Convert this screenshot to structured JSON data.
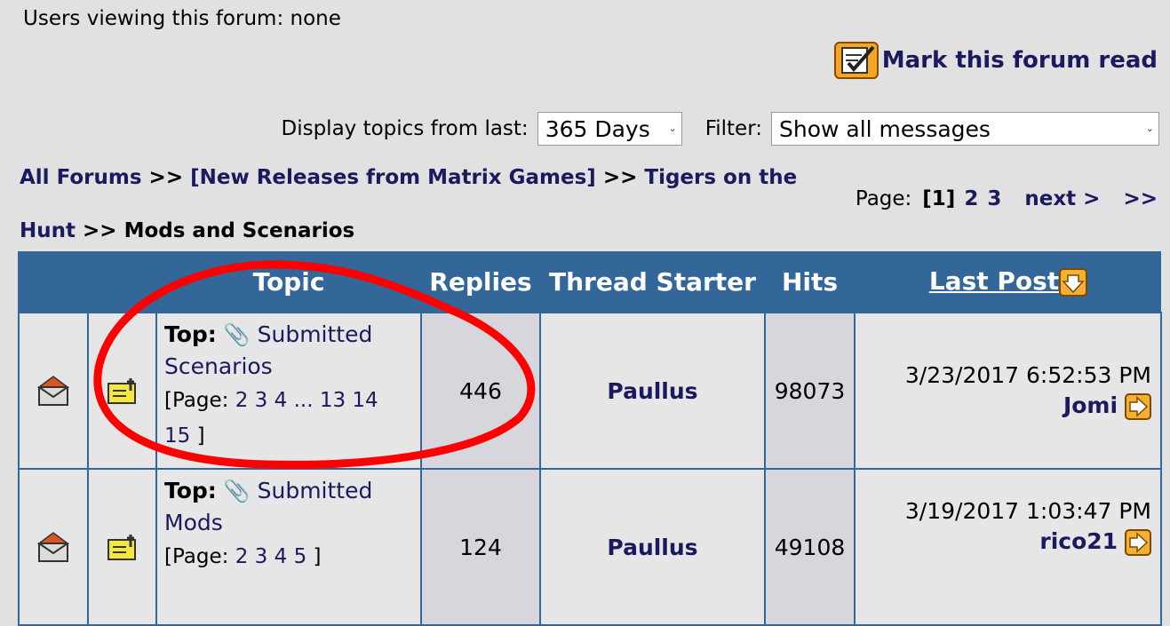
{
  "viewers": "Users viewing this forum: none",
  "mark_read": "Mark this forum read",
  "filters": {
    "display_label": "Display topics from last:",
    "days_value": "365 Days",
    "filter_label": "Filter:",
    "filter_value": "Show all messages"
  },
  "breadcrumb": {
    "all_forums": "All Forums",
    "sep1": ">>",
    "new_releases": "[New Releases from Matrix Games]",
    "sep2": ">>",
    "game_part1": "Tigers on the",
    "game_part2": "Hunt",
    "sep3": ">>",
    "current": "Mods and Scenarios"
  },
  "pager": {
    "label": "Page:",
    "current": "[1]",
    "p2": "2",
    "p3": "3",
    "next": "next >",
    "last": ">>"
  },
  "table": {
    "headers": {
      "topic": "Topic",
      "replies": "Replies",
      "starter": "Thread Starter",
      "hits": "Hits",
      "last_post": "Last Post"
    },
    "rows": [
      {
        "prefix": "Top:",
        "title_l1": "Submitted",
        "title_l2": "Scenarios",
        "page_open": "[Page:",
        "pages": [
          "2",
          "3",
          "4",
          "...",
          "13",
          "14",
          "15"
        ],
        "page_close": "]",
        "replies": "446",
        "starter": "Paullus",
        "hits": "98073",
        "last_date": "3/23/2017 6:52:53 PM",
        "last_user": "Jomi"
      },
      {
        "prefix": "Top:",
        "title_l1": "Submitted",
        "title_l2": "Mods",
        "page_open": "[Page:",
        "pages": [
          "2",
          "3",
          "4",
          "5"
        ],
        "page_close": "]",
        "replies": "124",
        "starter": "Paullus",
        "hits": "49108",
        "last_date": "3/19/2017 1:03:47 PM",
        "last_user": "rico21"
      }
    ]
  },
  "colors": {
    "header_bg": "#336699",
    "link": "#1a1a5e",
    "annotation": "#ff0000"
  }
}
